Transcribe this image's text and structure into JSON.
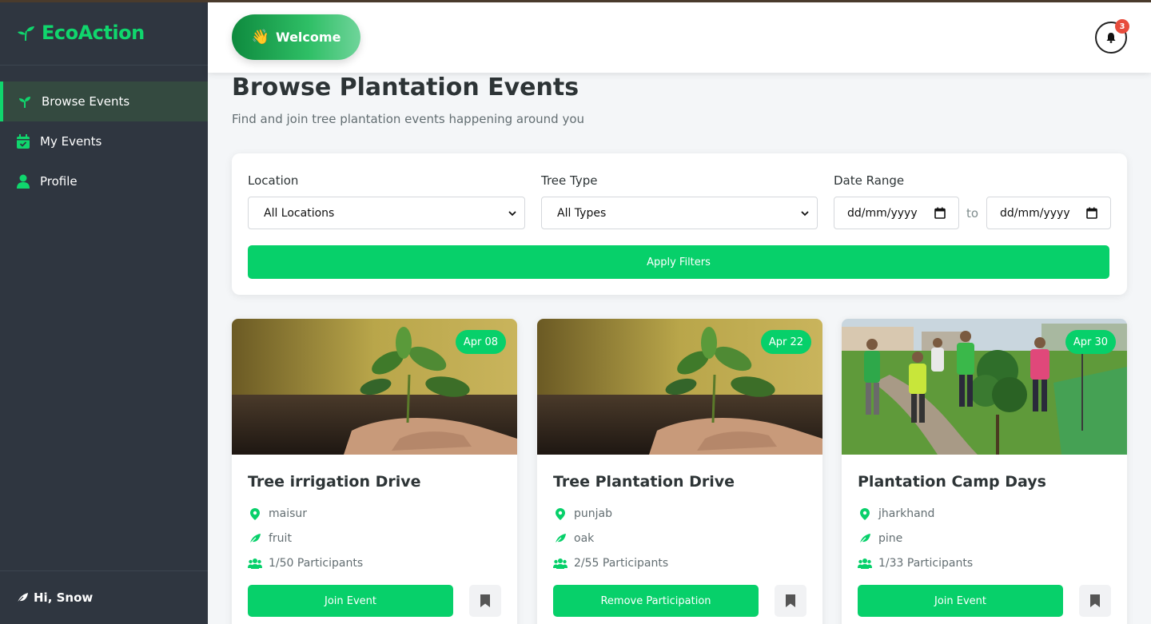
{
  "app": {
    "name": "EcoAction"
  },
  "sidebar": {
    "items": [
      {
        "label": "Browse Events",
        "icon": "seedling-icon",
        "active": true
      },
      {
        "label": "My Events",
        "icon": "calendar-check-icon",
        "active": false
      },
      {
        "label": "Profile",
        "icon": "user-icon",
        "active": false
      }
    ],
    "footer": {
      "greeting": "Hi, Snow",
      "icon": "leaf-icon"
    }
  },
  "header": {
    "welcome_label": "Welcome",
    "welcome_emoji": "👋",
    "notification_count": "3"
  },
  "main": {
    "title": "Browse Plantation Events",
    "subtitle": "Find and join tree plantation events happening around you"
  },
  "filters": {
    "location_label": "Location",
    "location_value": "All Locations",
    "tree_type_label": "Tree Type",
    "tree_type_value": "All Types",
    "date_range_label": "Date Range",
    "date_from_placeholder": "dd/mm/yyyy",
    "date_to_placeholder": "dd/mm/yyyy",
    "to_text": "to",
    "apply_label": "Apply Filters"
  },
  "events": [
    {
      "date": "Apr 08",
      "title": "Tree irrigation Drive",
      "location": "maisur",
      "tree": "fruit",
      "participants": "1/50 Participants",
      "action": "Join Event",
      "image": "sapling-photo"
    },
    {
      "date": "Apr 22",
      "title": "Tree Plantation Drive",
      "location": "punjab",
      "tree": "oak",
      "participants": "2/55 Participants",
      "action": "Remove Participation",
      "image": "sapling-photo"
    },
    {
      "date": "Apr 30",
      "title": "Plantation Camp Days",
      "location": "jharkhand",
      "tree": "pine",
      "participants": "1/33 Participants",
      "action": "Join Event",
      "image": "group-planting-photo"
    }
  ],
  "colors": {
    "brand": "#10d66d",
    "accent": "#07d06a",
    "sidebar": "#2f3640",
    "badge": "#e74c3c"
  }
}
